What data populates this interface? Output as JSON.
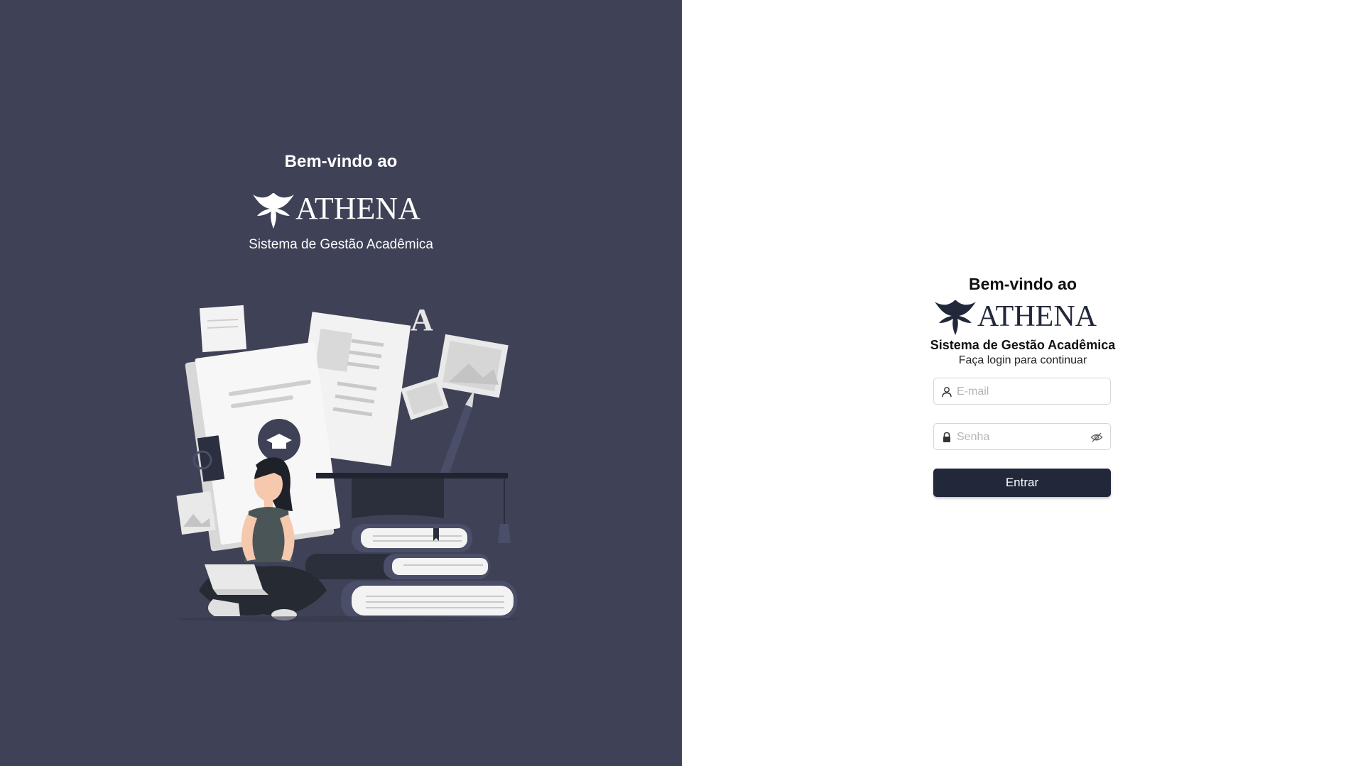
{
  "left": {
    "welcome": "Bem-vindo ao",
    "brand": "ATHENA",
    "system_name": "Sistema de Gestão Acadêmica",
    "illustration_letter": "A"
  },
  "login": {
    "welcome": "Bem-vindo ao",
    "brand": "ATHENA",
    "system_name": "Sistema de Gestão Acadêmica",
    "subtitle": "Faça login para continuar",
    "email_placeholder": "E-mail",
    "password_placeholder": "Senha",
    "submit_label": "Entrar"
  },
  "icons": {
    "logo": "phoenix-logo-icon",
    "email": "user-icon",
    "password": "lock-icon",
    "toggle_password": "eye-slash-icon"
  },
  "colors": {
    "left_panel_bg": "#3f4156",
    "button_bg": "#22283a",
    "brand_dark": "#22283a"
  }
}
